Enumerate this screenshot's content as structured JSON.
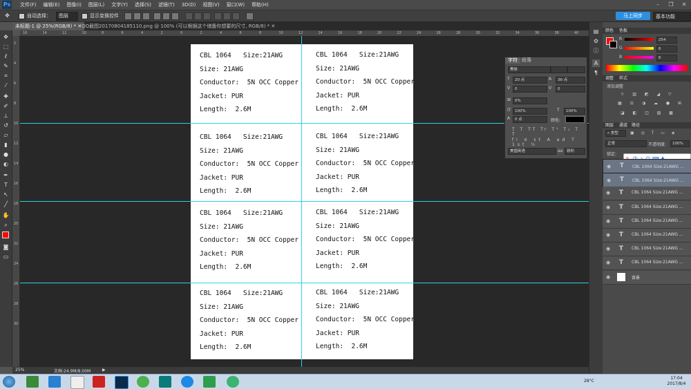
{
  "app": {
    "logo": "Ps"
  },
  "menu": [
    "文件(F)",
    "编辑(E)",
    "图像(I)",
    "图层(L)",
    "文字(Y)",
    "选择(S)",
    "滤镜(T)",
    "3D(D)",
    "视图(V)",
    "窗口(W)",
    "帮助(H)"
  ],
  "window_controls": {
    "minimize": "–",
    "restore": "❐",
    "close": "✕"
  },
  "options_bar": {
    "auto_select": "自动选择：",
    "auto_select_value": "图层",
    "show_transform": "显示变换控件",
    "cloud_button": "马上同步",
    "workspace": "基本功能"
  },
  "tabs": [
    {
      "label": "未标题-1 @ 25%(RGB/8) *"
    },
    {
      "label": "QQ截图20170804185110.png @ 100% (可以根据这个储备你想要的尺寸, RGB/8) *"
    }
  ],
  "ruler_h": [
    "16",
    "14",
    "12",
    "10",
    "8",
    "6",
    "4",
    "2",
    "0",
    "2",
    "4",
    "6",
    "8",
    "10",
    "12",
    "14",
    "16",
    "18",
    "20",
    "22",
    "24",
    "26",
    "28",
    "30",
    "32",
    "34",
    "36",
    "38",
    "40"
  ],
  "ruler_v": [
    "2",
    "4",
    "6",
    "8",
    "10",
    "12",
    "14",
    "16",
    "18",
    "20",
    "22",
    "24",
    "26",
    "28",
    "30"
  ],
  "labels": {
    "rows": [
      {
        "left": [
          "CBL 1064   Size:21AWG",
          "Size: 21AWG",
          "Conductor:  5N OCC Copper",
          "Jacket: PUR",
          "Length:  2.6M"
        ],
        "right": [
          "CBL 1064   Size:21AWG",
          "Size: 21AWG",
          "Conductor:  5N OCC Copper",
          "Jacket: PUR",
          "Length:  2.6M"
        ]
      },
      {
        "left": [
          "CBL 1064   Size:21AWG",
          "Size: 21AWG",
          "Conductor:  5N OCC Copper",
          "Jacket: PUR",
          "Length:  2.6M"
        ],
        "right": [
          "CBL 1064   Size:21AWG",
          "Size: 21AWG",
          "Conductor:  5N OCC Copper",
          "Jacket: PUR",
          "Length:  2.6M"
        ]
      },
      {
        "left": [
          "CBL 1064   Size:21AWG",
          "Size: 21AWG",
          "Conductor:  5N OCC Copper",
          "Jacket: PUR",
          "Length:  2.6M"
        ],
        "right": [
          "CBL 1064   Size:21AWG",
          "Size: 21AWG",
          "Conductor:  5N OCC Copper",
          "Jacket: PUR",
          "Length:  2.6M"
        ]
      },
      {
        "left": [
          "CBL 1064   Size:21AWG",
          "Size: 21AWG",
          "Conductor:  5N OCC Copper",
          "Jacket: PUR",
          "Length:  2.6M"
        ],
        "right": [
          "CBL 1064   Size:21AWG",
          "Size: 21AWG",
          "Conductor:  5N OCC Copper",
          "Jacket: PUR",
          "Length:  2.6M"
        ]
      }
    ]
  },
  "status": {
    "zoom": "25%",
    "doc_size": "文档:24.9M/8.00M"
  },
  "character_panel": {
    "tabs": [
      "字符",
      "段落"
    ],
    "font": "黑体",
    "size": "20 点",
    "leading": "36 点",
    "tracking_a": "0",
    "tracking_b": "0",
    "scale_pct": "0%",
    "v_scale": "100%",
    "h_scale": "100%",
    "baseline": "0 点",
    "color_label": "颜色:",
    "language": "美国英语",
    "antialias": "锐利"
  },
  "color_panel": {
    "tabs": [
      "颜色",
      "色板"
    ],
    "r": "254",
    "g": "6",
    "b": "6",
    "foreground": "#fe0606"
  },
  "adjustments_panel": {
    "tabs": [
      "调整",
      "样式"
    ],
    "title": "添加调整"
  },
  "layers_panel": {
    "tabs": [
      "图层",
      "通道",
      "路径"
    ],
    "kind": "类型",
    "blend": "正常",
    "opacity_label": "不透明度:",
    "opacity": "100%",
    "lock_label": "锁定:",
    "ime": [
      "中",
      "ゝ",
      "☺",
      "⌨",
      "♣"
    ],
    "layers": [
      {
        "name": "CBL 1064   Size:21AWG ...",
        "selected": true
      },
      {
        "name": "CBL 1064   Size:21AWG ...",
        "selected": true
      },
      {
        "name": "CBL 1064   Size:21AWG ...",
        "selected": false
      },
      {
        "name": "CBL 1064   Size:21AWG ...",
        "selected": false
      },
      {
        "name": "CBL 1064   Size:21AWG ...",
        "selected": false
      },
      {
        "name": "CBL 1064   Size:21AWG ...",
        "selected": false
      },
      {
        "name": "CBL 1064   Size:21AWG ...",
        "selected": false
      },
      {
        "name": "CBL 1064   Size:21AWG ...",
        "selected": false
      },
      {
        "name": "背景",
        "selected": false
      }
    ]
  },
  "taskbar": {
    "time": "17:04",
    "date": "2017/8/4",
    "temp": "28°C"
  }
}
